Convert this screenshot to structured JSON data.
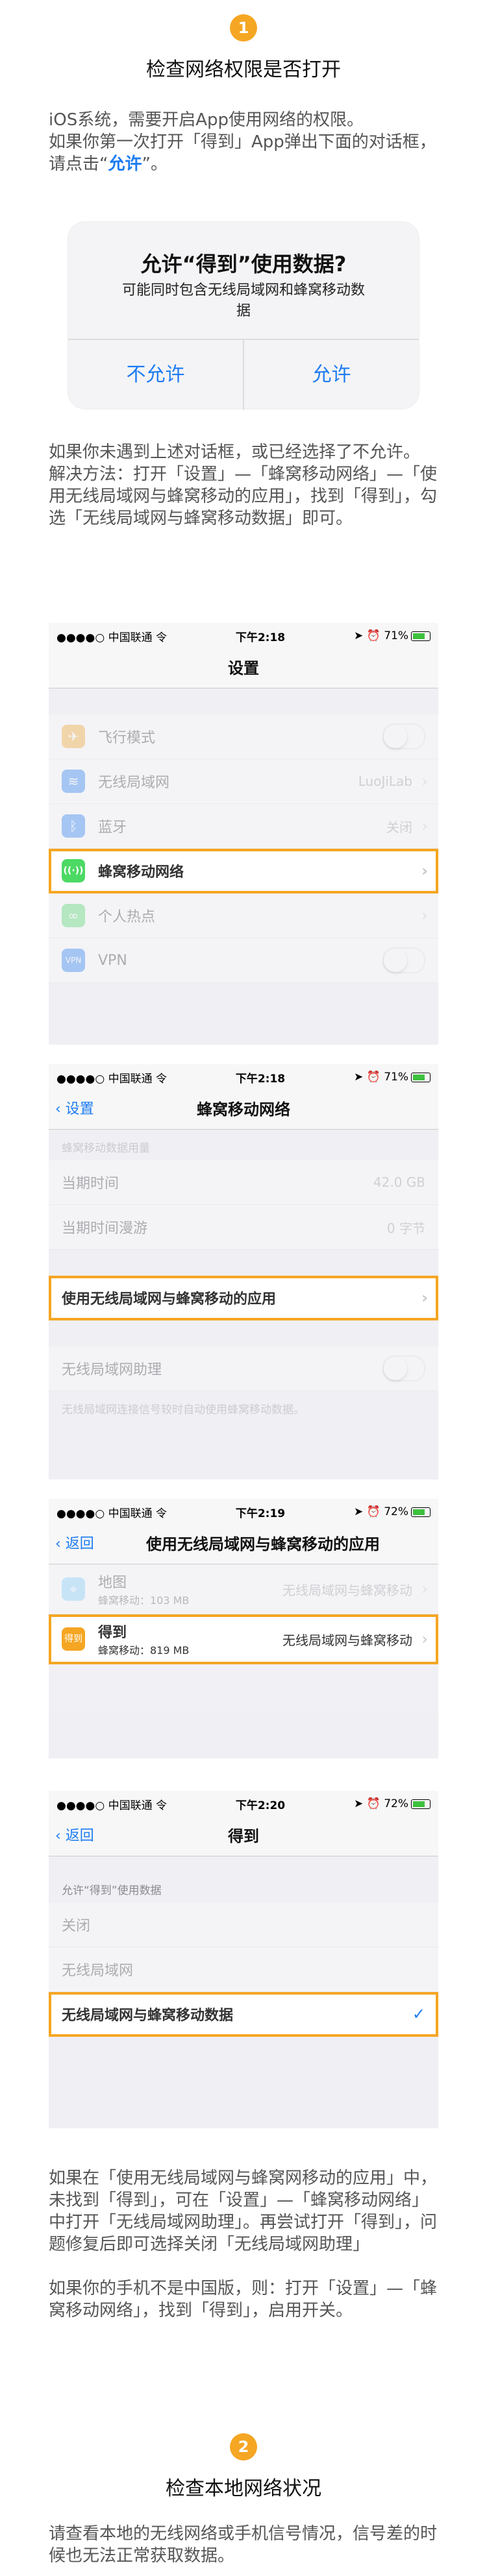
{
  "step1": {
    "num": "1",
    "title": "检查网络权限是否打开",
    "intro1": "iOS系统，需要开启App使用网络的权限。",
    "intro2a": "如果你第一次打开「得到」App弹出下面的对话框，请点击“",
    "intro2b": "允许",
    "intro2c": "”。",
    "alert": {
      "title": "允许“得到”使用数据?",
      "message_line1": "可能同时包含无线局域网和蜂窝移动数",
      "message_line2": "据",
      "deny": "不允许",
      "allow": "允许"
    },
    "para2": "如果你未遇到上述对话框，或已经选择了不允许。",
    "para3": "解决方法：打开「设置」—「蜂窝移动网络」—「使用无线局域网与蜂窝移动的应用」，找到「得到」，勾选「无线局域网与蜂窝移动数据」即可。"
  },
  "screen1": {
    "carrier": "●●●●○ 中国联通 令",
    "time": "下午2:18",
    "battery": "71%",
    "title": "设置",
    "rows": [
      {
        "label": "飞行模式",
        "icon": "✈",
        "color": "#f5a623"
      },
      {
        "label": "无线局域网",
        "icon": "⌔",
        "color": "#1d7cf2",
        "value": "LuoJiLab"
      },
      {
        "label": "蓝牙",
        "icon": "ᛒ",
        "color": "#1d7cf2",
        "value": "关闭"
      },
      {
        "label": "蜂窝移动网络",
        "icon": "((·))",
        "color": "#4cd964"
      },
      {
        "label": "个人热点",
        "icon": "∞",
        "color": "#4cd964"
      },
      {
        "label": "VPN",
        "icon": "VPN",
        "color": "#1d7cf2"
      }
    ]
  },
  "screen2": {
    "carrier": "●●●●○ 中国联通 令",
    "time": "下午2:18",
    "battery": "71%",
    "back": "设置",
    "title": "蜂窝移动网络",
    "section": "蜂窝移动数据用量",
    "rows": [
      {
        "label": "当期时间",
        "value": "42.0 GB"
      },
      {
        "label": "当期时间漫游",
        "value": "0 字节"
      }
    ],
    "highlight": "使用无线局域网与蜂窝移动的应用",
    "assist": "无线局域网助理",
    "assist_note": "无线局域网连接信号较时自动使用蜂窝移动数据。"
  },
  "screen3": {
    "carrier": "●●●●○ 中国联通 令",
    "time": "下午2:19",
    "battery": "72%",
    "back": "返回",
    "title": "使用无线局域网与蜂窝移动的应用",
    "map": {
      "name": "地图",
      "sub": "蜂窝移动：103 MB",
      "value": "无线局域网与蜂窝移动"
    },
    "app": {
      "name": "得到",
      "sub": "蜂窝移动：819 MB",
      "value": "无线局域网与蜂窝移动",
      "icon": "得到"
    }
  },
  "screen4": {
    "carrier": "●●●●○ 中国联通 令",
    "time": "下午2:20",
    "battery": "72%",
    "back": "返回",
    "title": "得到",
    "section": "允许“得到”使用数据",
    "options": [
      "关闭",
      "无线局域网",
      "无线局域网与蜂窝移动数据"
    ]
  },
  "para4": "如果在「使用无线局域网与蜂窝网移动的应用」中，未找到「得到」，可在「设置」—「蜂窝移动网络」中打开「无线局域网助理」。再尝试打开「得到」，问题修复后即可选择关闭「无线局域网助理」",
  "para5": "如果你的手机不是中国版，则：打开「设置」—「蜂窝移动网络」，找到「得到」，启用开关。",
  "step2": {
    "num": "2",
    "title": "检查本地网络状况",
    "para": "请查看本地的无线网络或手机信号情况，信号差的时候也无法正常获取数据。"
  },
  "colors": {
    "accent": "#f5a623",
    "blue": "#1d7cf2"
  }
}
